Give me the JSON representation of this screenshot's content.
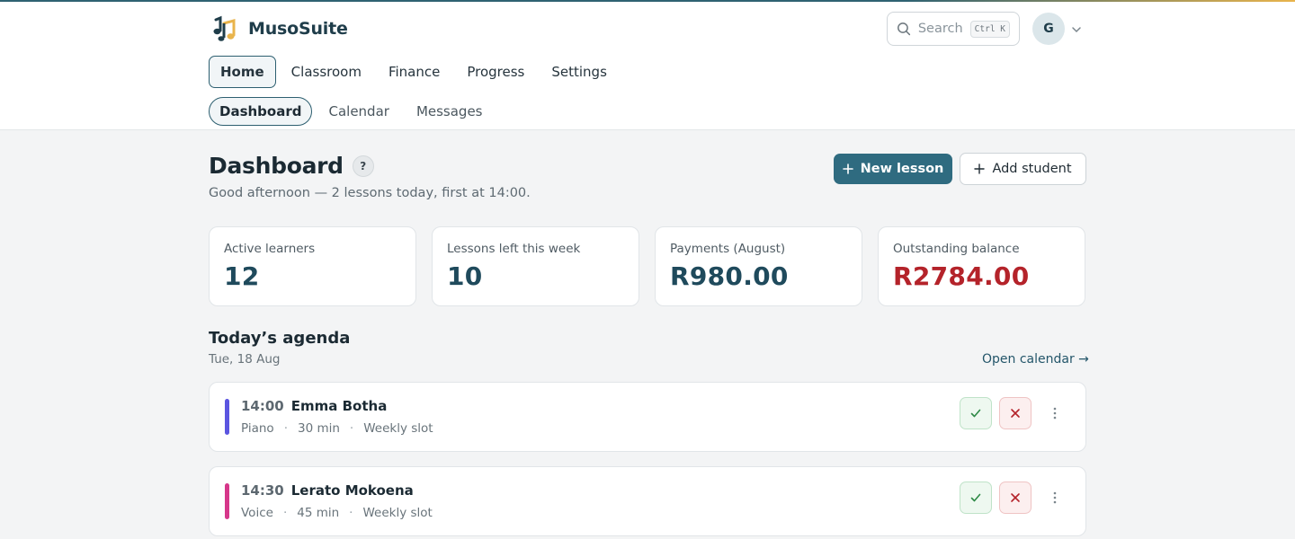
{
  "brand": {
    "name": "MusoSuite"
  },
  "search": {
    "placeholder": "Search",
    "shortcut": "Ctrl K"
  },
  "user": {
    "initial": "G"
  },
  "nav_primary": [
    {
      "label": "Home",
      "active": true
    },
    {
      "label": "Classroom"
    },
    {
      "label": "Finance"
    },
    {
      "label": "Progress"
    },
    {
      "label": "Settings"
    }
  ],
  "nav_secondary": [
    {
      "label": "Dashboard",
      "active": true
    },
    {
      "label": "Calendar"
    },
    {
      "label": "Messages"
    }
  ],
  "page": {
    "title": "Dashboard",
    "help": "?",
    "subtitle": "Good afternoon — 2 lessons today, first at 14:00."
  },
  "actions": {
    "new_lesson": "New lesson",
    "add_student": "Add student"
  },
  "stats": [
    {
      "label": "Active learners",
      "value": "12"
    },
    {
      "label": "Lessons left this week",
      "value": "10"
    },
    {
      "label": "Payments (August)",
      "value": "R980.00"
    },
    {
      "label": "Outstanding balance",
      "value": "R2784.00"
    }
  ],
  "agenda": {
    "title": "Today’s agenda",
    "date": "Tue, 18 Aug",
    "open_calendar": "Open calendar →",
    "lessons": [
      {
        "time": "14:00",
        "name": "Emma Botha",
        "instrument": "Piano",
        "duration": "30 min",
        "slot": "Weekly slot",
        "color": "#5b55e0"
      },
      {
        "time": "14:30",
        "name": "Lerato Mokoena",
        "instrument": "Voice",
        "duration": "45 min",
        "slot": "Weekly slot",
        "color": "#d6378a"
      }
    ]
  },
  "colors": {
    "accent": "#2f6b80",
    "danger": "#b4232a",
    "success": "#2f8a47"
  }
}
